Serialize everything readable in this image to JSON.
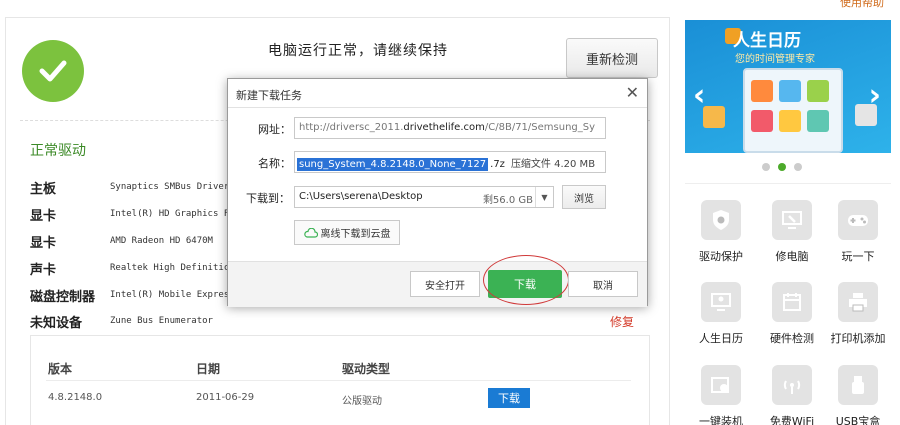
{
  "top_link": "使用帮助",
  "status": {
    "message": "电脑运行正常，请继续保持",
    "recheck_label": "重新检测"
  },
  "drivers": {
    "section_title": "正常驱动",
    "rows": [
      {
        "category": "主板",
        "description": "Synaptics SMBus Driver"
      },
      {
        "category": "显卡",
        "description": "Intel(R) HD Graphics F"
      },
      {
        "category": "显卡",
        "description": "AMD Radeon HD 6470M"
      },
      {
        "category": "声卡",
        "description": "Realtek High Definitic"
      },
      {
        "category": "磁盘控制器",
        "description": "Intel(R) Mobile Expres"
      },
      {
        "category": "未知设备",
        "description": "Zune Bus Enumerator"
      }
    ],
    "repair_label": "修复"
  },
  "detail_table": {
    "headers": [
      "版本",
      "日期",
      "驱动类型"
    ],
    "row": {
      "version": "4.8.2148.0",
      "date": "2011-06-29",
      "type": "公版驱动",
      "download_label": "下载"
    }
  },
  "banner": {
    "title": "人生日历",
    "subtitle": "您的时间管理专家"
  },
  "tools": [
    {
      "label": "驱动保护",
      "icon": "shield-gear-icon"
    },
    {
      "label": "修电脑",
      "icon": "wrench-monitor-icon"
    },
    {
      "label": "玩一下",
      "icon": "gamepad-icon"
    },
    {
      "label": "人生日历",
      "icon": "monitor-person-icon"
    },
    {
      "label": "硬件检测",
      "icon": "calendar-icon"
    },
    {
      "label": "打印机添加",
      "icon": "printer-icon"
    },
    {
      "label": "一键装机",
      "icon": "disc-install-icon"
    },
    {
      "label": "免费WiFi",
      "icon": "wifi-icon"
    },
    {
      "label": "USB宝盒",
      "icon": "usb-icon"
    }
  ],
  "dialog": {
    "title": "新建下载任务",
    "url_label": "网址：",
    "url_prefix": "http://driversc_2011.",
    "url_domain": "drivethelife.com",
    "url_suffix": "/C/8B/71/Semsung_Sy",
    "name_label": "名称：",
    "name_selected": "sung_System_4.8.2148.0_None_7127",
    "name_ext": ".7z",
    "name_size": "压缩文件 4.20 MB",
    "path_label": "下载到：",
    "path_value": "C:\\Users\\serena\\Desktop",
    "path_free": "剩56.0 GB",
    "browse_label": "浏览",
    "cloud_label": "离线下载到云盘",
    "open_label": "安全打开",
    "download_label": "下载",
    "cancel_label": "取消"
  }
}
